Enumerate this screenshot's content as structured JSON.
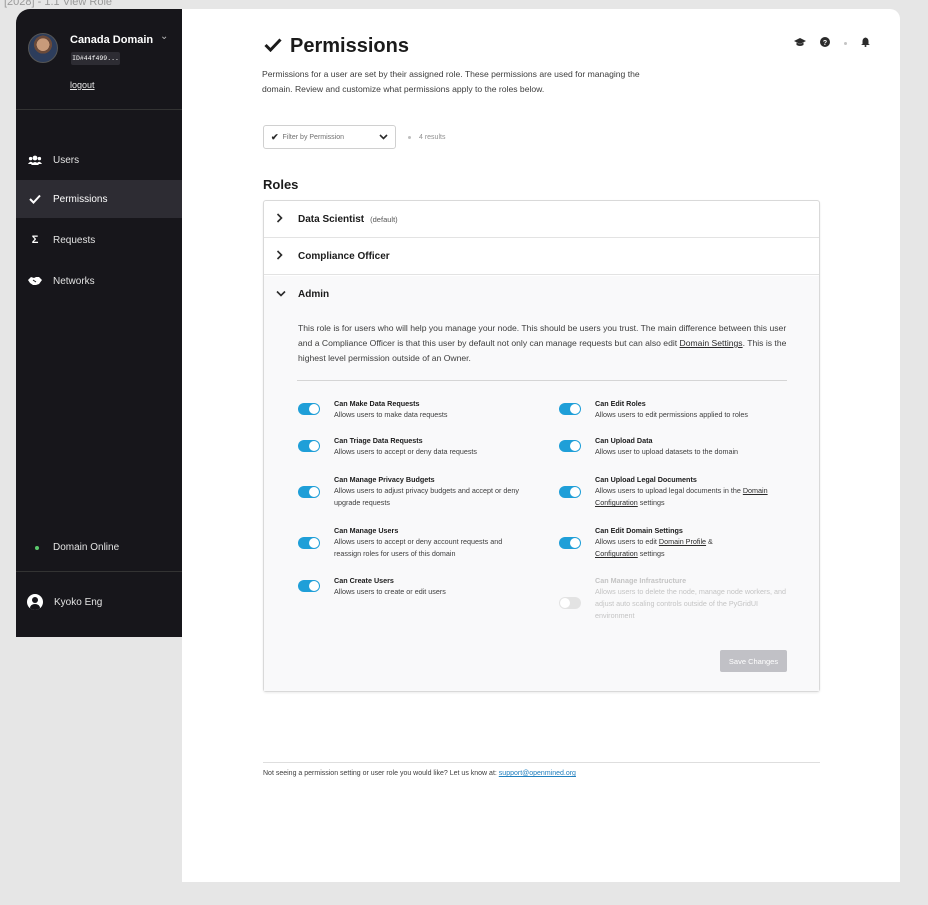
{
  "frame_label": "[2028] - 1.1 View Role",
  "sidebar": {
    "domain_name": "Canada Domain",
    "domain_id": "ID#44f499...",
    "logout_label": "logout",
    "nav": [
      {
        "label": "Users",
        "icon": "users-icon"
      },
      {
        "label": "Permissions",
        "icon": "check-icon"
      },
      {
        "label": "Requests",
        "icon": "sigma-icon"
      },
      {
        "label": "Networks",
        "icon": "handshake-icon"
      }
    ],
    "status_label": "Domain Online",
    "status_color": "#5bc96c",
    "user_name": "Kyoko Eng"
  },
  "header": {
    "title": "Permissions",
    "description": "Permissions for a user are set by their assigned role. These permissions are used for managing the domain. Review and customize what permissions apply to the roles below."
  },
  "filter": {
    "placeholder": "Filter by Permission",
    "results": "4 results"
  },
  "roles": {
    "heading": "Roles",
    "items": [
      {
        "name": "Data Scientist",
        "tag": "(default)"
      },
      {
        "name": "Compliance Officer",
        "tag": ""
      },
      {
        "name": "Admin",
        "tag": ""
      }
    ],
    "admin": {
      "desc_part1": "This role is for users who will help you manage your node. This should be users you trust. The main difference between this user and a Compliance Officer is that this user by default not only can manage requests but can also edit ",
      "desc_link": "Domain Settings",
      "desc_part2": ". This is the highest level permission outside of an Owner.",
      "permissions": [
        {
          "title": "Can Make Data Requests",
          "desc": "Allows users to make data requests",
          "enabled": true
        },
        {
          "title": "Can Triage Data Requests",
          "desc": "Allows users to accept or deny data requests",
          "enabled": true
        },
        {
          "title": "Can Manage Privacy Budgets",
          "desc": "Allows users to adjust privacy budgets and accept or deny upgrade requests",
          "enabled": true
        },
        {
          "title": "Can Manage Users",
          "desc": "Allows users to accept or deny account requests and reassign roles for users of this domain",
          "enabled": true
        },
        {
          "title": "Can Create Users",
          "desc": "Allows users to create or edit users",
          "enabled": true
        },
        {
          "title": "Can Edit Roles",
          "desc": "Allows users to edit permissions applied to roles",
          "enabled": true
        },
        {
          "title": "Can Upload Data",
          "desc": "Allows user to upload datasets to the domain",
          "enabled": true
        },
        {
          "title": "Can Upload Legal Documents",
          "desc_part1": "Allows users to upload legal documents in the ",
          "desc_link": "Domain Configuration",
          "desc_part2": " settings",
          "enabled": true
        },
        {
          "title": "Can Edit Domain Settings",
          "desc_part1": "Allows users to edit ",
          "desc_link": "Domain Profile",
          "desc_mid": " & ",
          "desc_link2": "Configuration",
          "desc_part2": " settings",
          "enabled": true
        },
        {
          "title": "Can Manage Infrastructure",
          "desc": "Allows users to delete the node, manage node workers, and adjust auto scaling controls outside of the PyGridUI environment",
          "enabled": false
        }
      ],
      "save_label": "Save Changes"
    }
  },
  "footer": {
    "text": "Not seeing a permission setting or user role you would like? Let us know at: ",
    "link": "support@openmined.org"
  },
  "colors": {
    "accent": "#1f9fd8",
    "sidebar_bg": "#17161b",
    "sidebar_active": "#2d2c33"
  }
}
